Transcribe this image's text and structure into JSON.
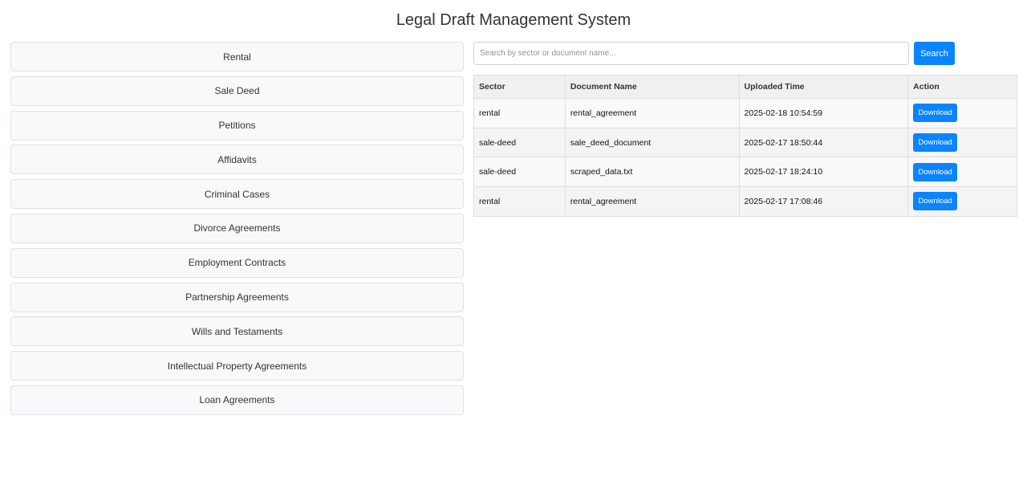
{
  "header": {
    "title": "Legal Draft Management System"
  },
  "sidebar": {
    "items": [
      {
        "label": "Rental"
      },
      {
        "label": "Sale Deed"
      },
      {
        "label": "Petitions"
      },
      {
        "label": "Affidavits"
      },
      {
        "label": "Criminal Cases"
      },
      {
        "label": "Divorce Agreements"
      },
      {
        "label": "Employment Contracts"
      },
      {
        "label": "Partnership Agreements"
      },
      {
        "label": "Wills and Testaments"
      },
      {
        "label": "Intellectual Property Agreements"
      },
      {
        "label": "Loan Agreements"
      }
    ]
  },
  "search": {
    "placeholder": "Search by sector or document name...",
    "value": "",
    "button_label": "Search"
  },
  "table": {
    "headers": [
      "Sector",
      "Document Name",
      "Uploaded Time",
      "Action"
    ],
    "rows": [
      {
        "sector": "rental",
        "document_name": "rental_agreement",
        "uploaded_time": "2025-02-18 10:54:59",
        "action_label": "Download"
      },
      {
        "sector": "sale-deed",
        "document_name": "sale_deed_document",
        "uploaded_time": "2025-02-17 18:50:44",
        "action_label": "Download"
      },
      {
        "sector": "sale-deed",
        "document_name": "scraped_data.txt",
        "uploaded_time": "2025-02-17 18:24:10",
        "action_label": "Download"
      },
      {
        "sector": "rental",
        "document_name": "rental_agreement",
        "uploaded_time": "2025-02-17 17:08:46",
        "action_label": "Download"
      }
    ]
  },
  "colors": {
    "accent": "#0a84ff",
    "sidebar_bg": "#f8f9fb",
    "header_bg": "#f0f0f0"
  }
}
